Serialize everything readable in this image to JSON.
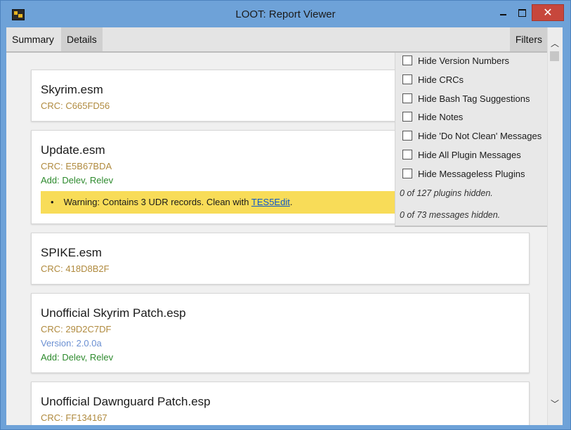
{
  "window": {
    "title": "LOOT: Report Viewer"
  },
  "nav": {
    "summary": "Summary",
    "details": "Details",
    "filters": "Filters"
  },
  "warning_bullet": "•",
  "plugins": [
    {
      "name": "Skyrim.esm",
      "crc": "CRC: C665FD56"
    },
    {
      "name": "Update.esm",
      "crc": "CRC: E5B67BDA",
      "tags": "Add: Delev, Relev",
      "warning": {
        "text": "Warning: Contains 3 UDR records. Clean with ",
        "link": "TES5Edit",
        "suffix": "."
      }
    },
    {
      "name": "SPIKE.esm",
      "crc": "CRC: 418D8B2F"
    },
    {
      "name": "Unofficial Skyrim Patch.esp",
      "crc": "CRC: 29D2C7DF",
      "version": "Version: 2.0.0a",
      "tags": "Add: Delev, Relev"
    },
    {
      "name": "Unofficial Dawnguard Patch.esp",
      "crc": "CRC: FF134167"
    }
  ],
  "filters": {
    "options": [
      "Hide Version Numbers",
      "Hide CRCs",
      "Hide Bash Tag Suggestions",
      "Hide Notes",
      "Hide 'Do Not Clean' Messages",
      "Hide All Plugin Messages",
      "Hide Messageless Plugins"
    ],
    "plugins_hidden": "0 of 127 plugins hidden.",
    "messages_hidden": "0 of 73 messages hidden."
  }
}
